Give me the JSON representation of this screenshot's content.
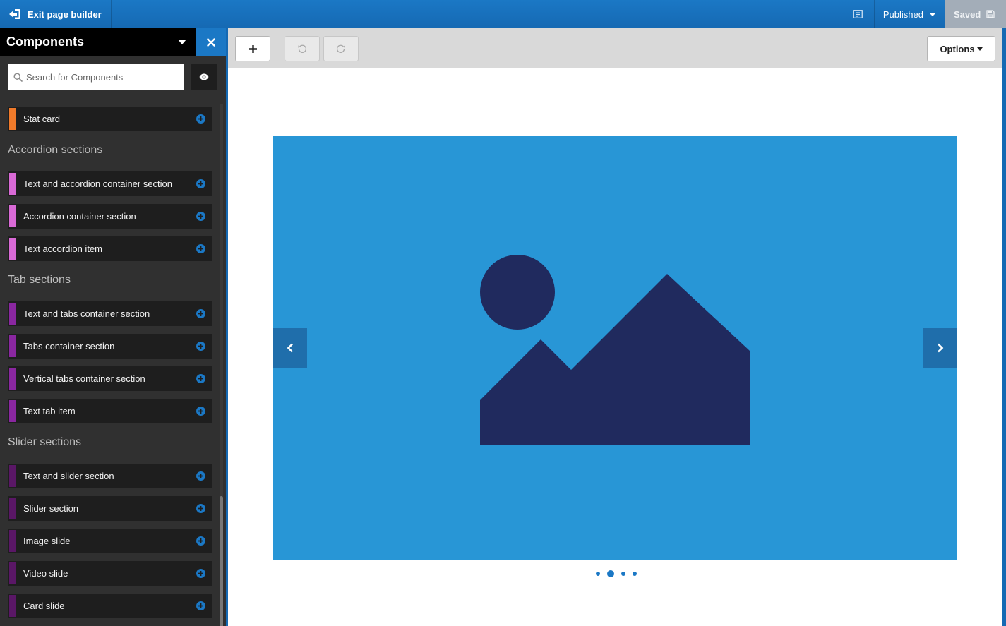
{
  "topbar": {
    "exit_label": "Exit page builder",
    "published_label": "Published",
    "saved_label": "Saved"
  },
  "sidebar": {
    "title": "Components",
    "search_placeholder": "Search for Components",
    "items_top": [
      {
        "label": "Stat card",
        "color": "#f07a2a"
      }
    ],
    "sections": [
      {
        "title": "Accordion sections",
        "items": [
          {
            "label": "Text and accordion container section",
            "color": "#d96ad6"
          },
          {
            "label": "Accordion container section",
            "color": "#d96ad6"
          },
          {
            "label": "Text accordion item",
            "color": "#d96ad6"
          }
        ]
      },
      {
        "title": "Tab sections",
        "items": [
          {
            "label": "Text and tabs container section",
            "color": "#8a27a0"
          },
          {
            "label": "Tabs container section",
            "color": "#8a27a0"
          },
          {
            "label": "Vertical tabs container section",
            "color": "#8a27a0"
          },
          {
            "label": "Text tab item",
            "color": "#8a27a0"
          }
        ]
      },
      {
        "title": "Slider sections",
        "items": [
          {
            "label": "Text and slider section",
            "color": "#5a1766"
          },
          {
            "label": "Slider section",
            "color": "#5a1766"
          },
          {
            "label": "Image slide",
            "color": "#5a1766"
          },
          {
            "label": "Video slide",
            "color": "#5a1766"
          },
          {
            "label": "Card slide",
            "color": "#5a1766"
          }
        ]
      }
    ]
  },
  "toolbar": {
    "add_label": "+",
    "options_label": "Options"
  },
  "canvas": {
    "slider": {
      "slide_count": 4,
      "active_index": 1,
      "background": "#2896d6",
      "placeholder_color": "#202a5e"
    }
  }
}
